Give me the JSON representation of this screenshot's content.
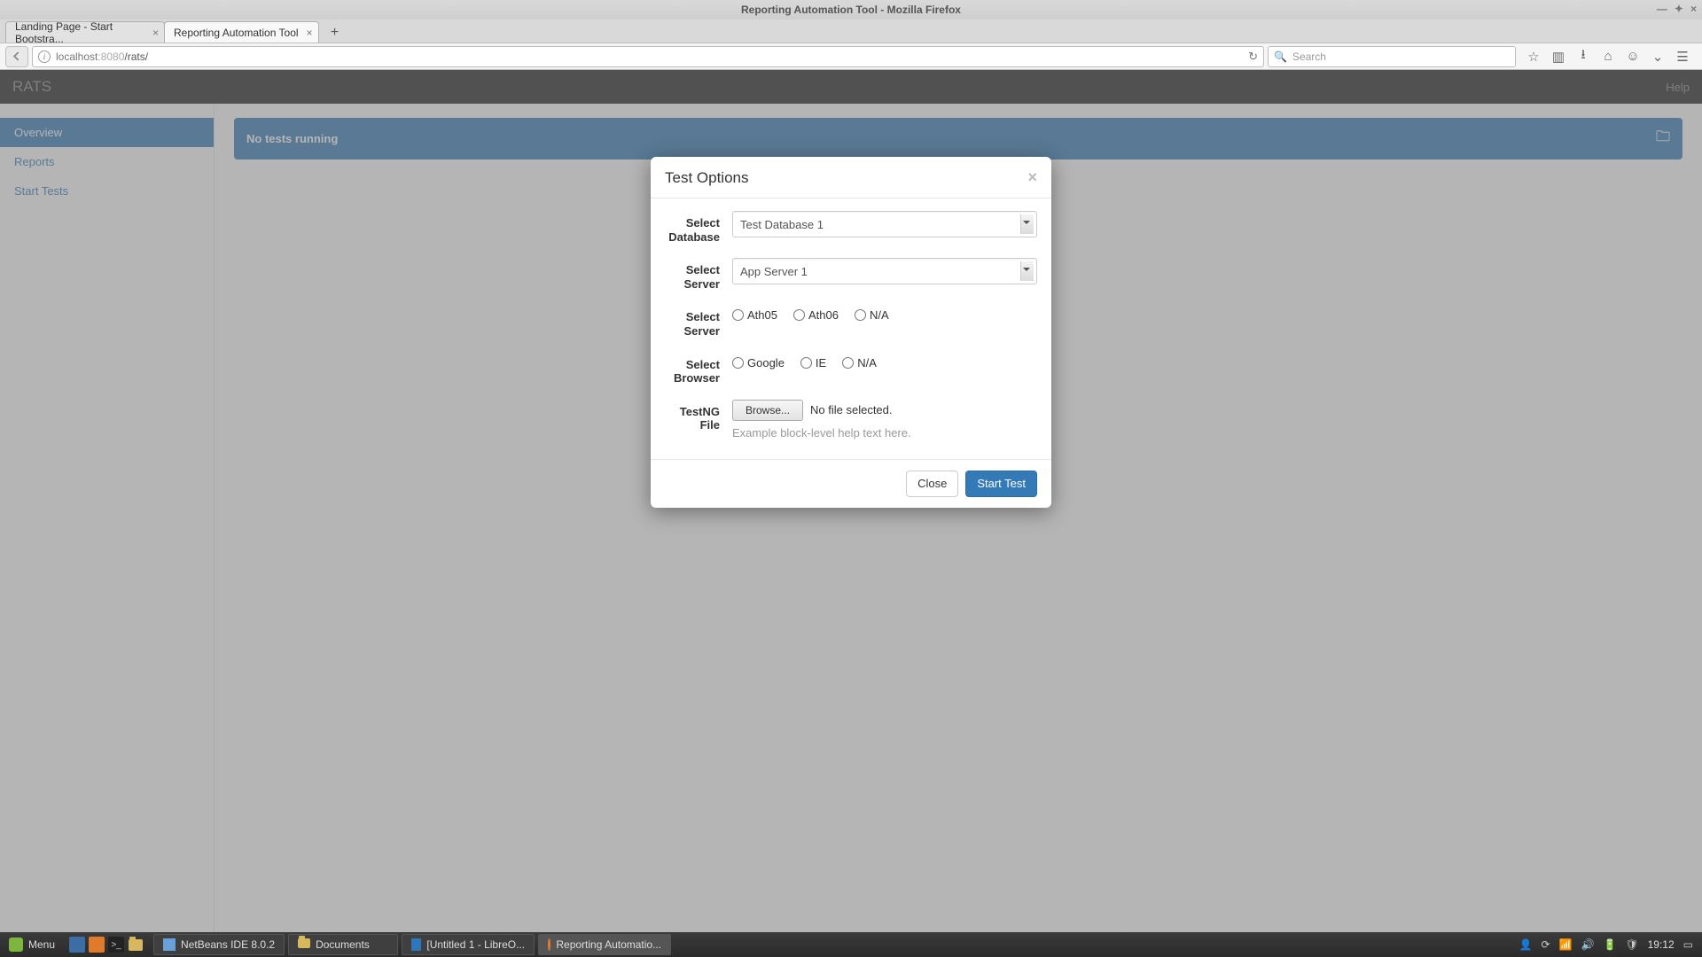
{
  "window": {
    "title": "Reporting Automation Tool - Mozilla Firefox"
  },
  "browser": {
    "tabs": [
      {
        "label": "Landing Page - Start Bootstra..."
      },
      {
        "label": "Reporting Automation Tool"
      }
    ],
    "url_host": "localhost",
    "url_port": ":8080",
    "url_path": "/rats/",
    "search_placeholder": "Search"
  },
  "app": {
    "brand": "RATS",
    "help": "Help",
    "sidebar": {
      "items": [
        {
          "label": "Overview"
        },
        {
          "label": "Reports"
        },
        {
          "label": "Start Tests"
        }
      ]
    },
    "status_text": "No tests running"
  },
  "modal": {
    "title": "Test Options",
    "labels": {
      "database": "Select Database",
      "server": "Select Server",
      "server2": "Select Server",
      "browser": "Select Browser",
      "file": "TestNG File"
    },
    "database_value": "Test Database 1",
    "server_value": "App Server 1",
    "server_options": [
      {
        "label": "Ath05"
      },
      {
        "label": "Ath06"
      },
      {
        "label": "N/A"
      }
    ],
    "browser_options": [
      {
        "label": "Google"
      },
      {
        "label": "IE"
      },
      {
        "label": "N/A"
      }
    ],
    "browse_label": "Browse...",
    "file_status": "No file selected.",
    "help_text": "Example block-level help text here.",
    "close_label": "Close",
    "start_label": "Start Test"
  },
  "taskbar": {
    "menu": "Menu",
    "tasks": [
      {
        "label": "NetBeans IDE 8.0.2"
      },
      {
        "label": "Documents"
      },
      {
        "label": "[Untitled 1 - LibreO..."
      },
      {
        "label": "Reporting Automatio..."
      }
    ],
    "clock": "19:12"
  }
}
